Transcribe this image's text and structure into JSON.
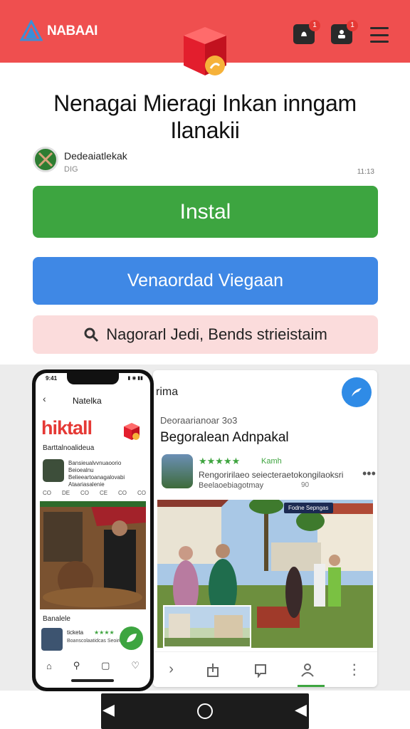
{
  "header": {
    "brand": "NABAAI",
    "badge_1": "1",
    "badge_2": "1"
  },
  "title": "Nenagai Mieragi Inkan inngam Ilanakii",
  "developer": {
    "name": "Dedeaiatlekak",
    "sub": "DIG",
    "size": "11:13"
  },
  "buttons": {
    "install": "Instal",
    "download": "Venaordad Viegaan",
    "search": "Nagorarl Jedi, Bends strieistaim"
  },
  "screenshot_card": {
    "title": "rima",
    "label": "Deoraarianoar 3o3",
    "heading": "Begoralean Adnpakal",
    "app_stars": "★★★★★",
    "app_stars_label": "Kamh",
    "app_desc1": "Rengoririlaeo seiecteraetokongilaoksri",
    "app_desc2": "Beelaoebiagotmay",
    "app_num": "90",
    "photo_badge": "Fodne Sepngas"
  },
  "phone": {
    "time": "9:41",
    "status": "▮ ◉ ▮▮",
    "title": "Natelka",
    "logo": "hiktall",
    "section": "Barttalnoalideua",
    "item_text": "Bansieualvvnuaoorio Beioealnu Belieeartoanagalovabi Ataariasalenie",
    "meta": [
      "CO",
      "DE",
      "CO",
      "CE",
      "CO",
      "CO"
    ],
    "sub_section": "Banalele",
    "stars": "★★★★",
    "stars_label": "ticketa",
    "item_text2": "Boanscolaatidcas Seoiriauuuohtei"
  }
}
